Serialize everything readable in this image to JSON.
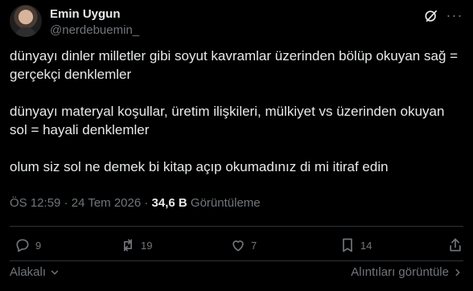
{
  "author": {
    "name": "Emin Uygun",
    "handle": "@nerdebuemin_"
  },
  "tweet": {
    "paragraphs": [
      "dünyayı dinler milletler gibi soyut kavramlar üzerinden bölüp okuyan sağ = gerçekçi denklemler",
      "dünyayı materyal koşullar, üretim ilişkileri, mülkiyet vs üzerinden okuyan sol = hayali denklemler",
      "olum siz sol ne demek bi kitap açıp okumadınız di mi itiraf edin"
    ],
    "time": "ÖS 12:59",
    "date": "24 Tem 2026",
    "separator": "·",
    "views_count": "34,6 B",
    "views_label": "Görüntüleme"
  },
  "actions": {
    "replies": "9",
    "reposts": "19",
    "likes": "7",
    "bookmarks": "14"
  },
  "footer": {
    "left_label": "Alakalı",
    "right_label": "Alıntıları görüntüle"
  },
  "icons": {
    "grok": "grok-icon",
    "more": "more-icon",
    "reply": "reply-icon",
    "repost": "repost-icon",
    "like": "heart-icon",
    "bookmark": "bookmark-icon",
    "share": "share-icon"
  }
}
